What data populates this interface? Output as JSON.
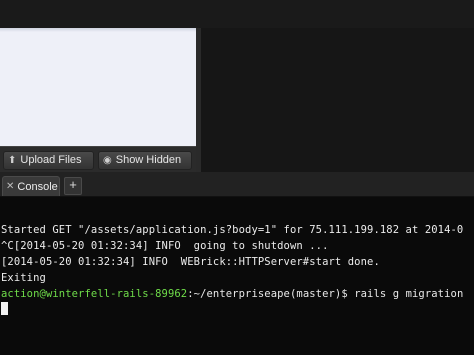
{
  "file_panel": {
    "upload_label": "Upload Files",
    "show_hidden_label": "Show Hidden",
    "upload_icon": "upload-icon",
    "eye_icon": "eye-icon"
  },
  "tabs": {
    "console_label": "Console",
    "add_label": "+"
  },
  "console": {
    "lines": [
      "Started GET \"/assets/application.js?body=1\" for 75.111.199.182 at 2014-0",
      "^C[2014-05-20 01:32:34] INFO  going to shutdown ...",
      "[2014-05-20 01:32:34] INFO  WEBrick::HTTPServer#start done.",
      "Exiting"
    ],
    "prompt_user": "action@winterfell-rails-89962",
    "prompt_rest": ":~/enterpriseape(master)$ rails g migration"
  }
}
